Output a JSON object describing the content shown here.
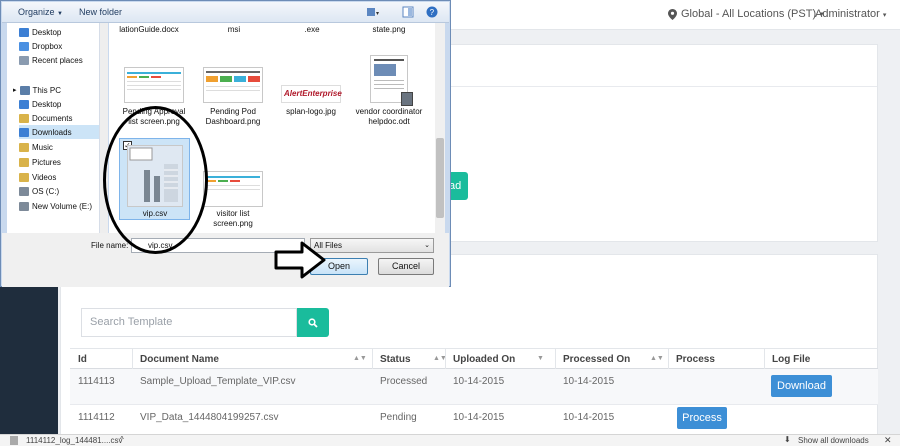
{
  "app": {
    "location": "Global - All Locations (PST)",
    "user": "Administrator",
    "partial_button_label": "ad",
    "search_placeholder": "Search Template",
    "table": {
      "headers": [
        "Id",
        "Document Name",
        "Status",
        "Uploaded On",
        "Processed On",
        "Process",
        "Log File"
      ],
      "rows": [
        {
          "id": "1114113",
          "name": "Sample_Upload_Template_VIP.csv",
          "status": "Processed",
          "uploaded": "10-14-2015",
          "processed": "10-14-2015",
          "process_btn": "",
          "log_btn": "Download"
        },
        {
          "id": "1114112",
          "name": "VIP_Data_1444804199257.csv",
          "status": "Pending",
          "uploaded": "10-14-2015",
          "processed": "10-14-2015",
          "process_btn": "Process",
          "log_btn": ""
        }
      ]
    },
    "downloads_item": "1114112_log_144481....csv",
    "downloads_show_all": "Show all downloads"
  },
  "dialog": {
    "toolbar": {
      "organize": "Organize",
      "new_folder": "New folder"
    },
    "nav": [
      {
        "label": "Desktop",
        "color": "#3c7fd4"
      },
      {
        "label": "Dropbox",
        "color": "#4a90e2"
      },
      {
        "label": "Recent places",
        "color": "#8a9bb0"
      },
      {
        "label": "This PC",
        "color": "#5b7ea8"
      },
      {
        "label": "Desktop",
        "color": "#3c7fd4"
      },
      {
        "label": "Documents",
        "color": "#d9b34a"
      },
      {
        "label": "Downloads",
        "color": "#3c7fd4"
      },
      {
        "label": "Music",
        "color": "#d9b34a"
      },
      {
        "label": "Pictures",
        "color": "#d9b34a"
      },
      {
        "label": "Videos",
        "color": "#d9b34a"
      },
      {
        "label": "OS (C:)",
        "color": "#7d8a99"
      },
      {
        "label": "New Volume (E:)",
        "color": "#7d8a99"
      }
    ],
    "files": {
      "top_row": [
        "lationGuide.docx",
        "msi",
        ".exe",
        "state.png"
      ],
      "pending_approval": "Pending Approval list screen.png",
      "pending_pod": "Pending Pod Dashboard.png",
      "splan_logo": "splan-logo.jpg",
      "logo_text": "AlertEnterprise",
      "vendor_doc": "vendor coordinator helpdoc.odt",
      "vip_csv": "vip.csv",
      "visitor_list": "visitor list screen.png"
    },
    "file_name_label": "File name:",
    "file_name_value": "vip.csv",
    "file_type": "All Files",
    "open_label": "Open",
    "cancel_label": "Cancel"
  }
}
